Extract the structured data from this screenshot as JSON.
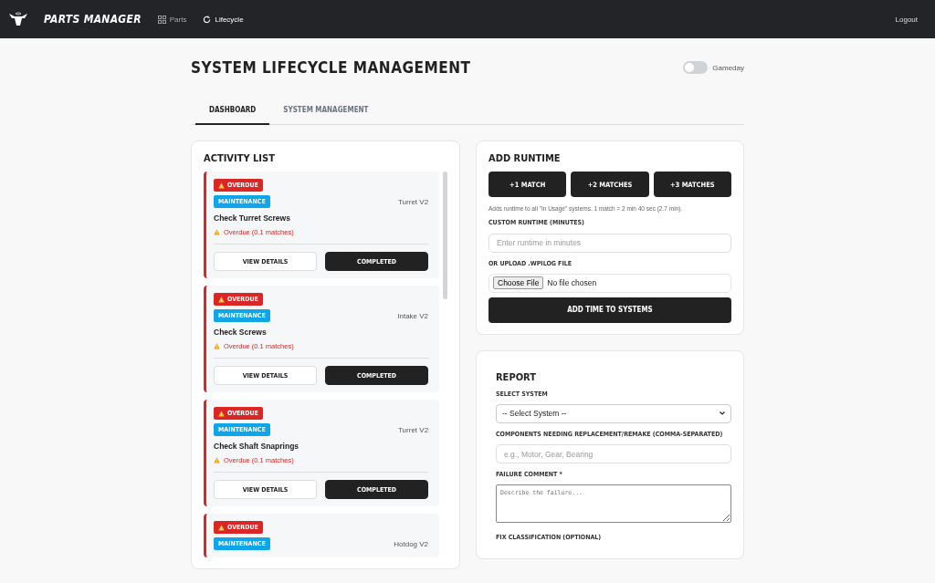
{
  "navbar": {
    "brand": "PARTS MANAGER",
    "links": [
      {
        "label": "Parts",
        "selected": false
      },
      {
        "label": "Lifecycle",
        "selected": true
      }
    ],
    "logout": "Logout"
  },
  "page": {
    "title": "SYSTEM LIFECYCLE MANAGEMENT",
    "gameday": {
      "label": "Gameday",
      "on": false
    }
  },
  "tabs": [
    {
      "label": "DASHBOARD",
      "selected": true
    },
    {
      "label": "SYSTEM MANAGEMENT",
      "selected": false
    }
  ],
  "activity_list": {
    "title": "ACTIVITY LIST",
    "items": [
      {
        "status": "OVERDUE",
        "type": "MAINTENANCE",
        "system": "Turret V2",
        "task": "Check Turret Screws",
        "due": "Overdue (0.1 matches)",
        "buttons": [
          "VIEW DETAILS",
          "COMPLETED"
        ]
      },
      {
        "status": "OVERDUE",
        "type": "MAINTENANCE",
        "system": "Intake V2",
        "task": "Check Screws",
        "due": "Overdue (0.1 matches)",
        "buttons": [
          "VIEW DETAILS",
          "COMPLETED"
        ]
      },
      {
        "status": "OVERDUE",
        "type": "MAINTENANCE",
        "system": "Turret V2",
        "task": "Check Shaft Snaprings",
        "due": "Overdue (0.1 matches)",
        "buttons": [
          "VIEW DETAILS",
          "COMPLETED"
        ]
      },
      {
        "status": "OVERDUE",
        "type": "MAINTENANCE",
        "system": "Hotdog V2"
      }
    ]
  },
  "add_runtime": {
    "title": "ADD RUNTIME",
    "quick_buttons": [
      "+1 MATCH",
      "+2 MATCHES",
      "+3 MATCHES"
    ],
    "note": "Adds runtime to all \"In Usage\" systems. 1 match = 2 min 40 sec (2.7 min).",
    "custom_label": "CUSTOM RUNTIME (MINUTES)",
    "custom_placeholder": "Enter runtime in minutes",
    "upload_label": "OR UPLOAD .WPILOG FILE",
    "file_button": "Choose File",
    "file_status": "No file chosen",
    "submit": "ADD TIME TO SYSTEMS"
  },
  "report": {
    "title": "REPORT",
    "system_label": "SELECT SYSTEM",
    "system_value": "-- Select System --",
    "components_label": "COMPONENTS NEEDING REPLACEMENT/REMAKE (COMMA-SEPARATED)",
    "components_placeholder": "e.g., Motor, Gear, Bearing",
    "failure_label": "FAILURE COMMENT *",
    "failure_placeholder": "Describe the failure...",
    "fix_label": "FIX CLASSIFICATION (OPTIONAL)"
  }
}
